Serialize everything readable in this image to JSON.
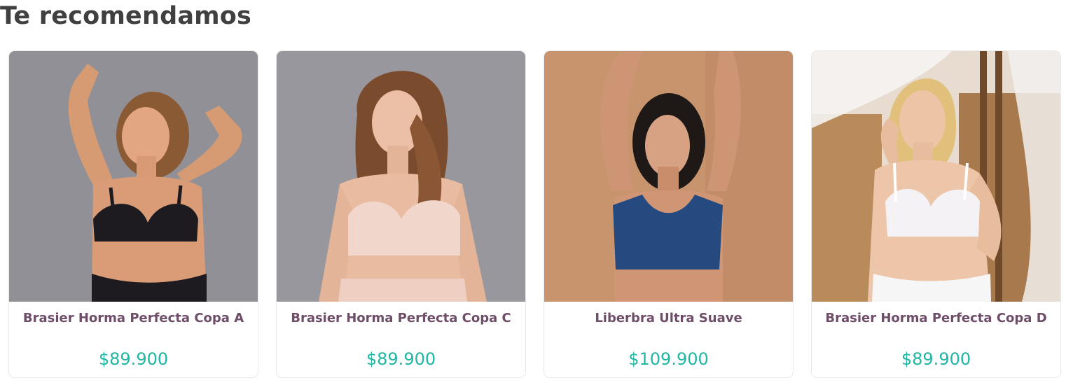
{
  "section": {
    "title": "Te recomendamos"
  },
  "colors": {
    "title": "#404040",
    "product_name": "#6d4d68",
    "price": "#1eb7a2",
    "card_border": "#e9e9e9"
  },
  "products": [
    {
      "name": "Brasier Horma Perfecta Copa A",
      "price": "$89.900",
      "image_background": "#8e8c92",
      "garment_color": "#1d1b1f",
      "hair_color": "#8a5a34"
    },
    {
      "name": "Brasier Horma Perfecta Copa C",
      "price": "$89.900",
      "image_background": "#98979d",
      "garment_color": "#f1d6cc",
      "hair_color": "#7a4b2c"
    },
    {
      "name": "Liberbra Ultra Suave",
      "price": "$109.900",
      "image_background": "#c8946e",
      "garment_color": "#244a80",
      "hair_color": "#1e1916"
    },
    {
      "name": "Brasier Horma Perfecta Copa D",
      "price": "$89.900",
      "image_background": "#e7dccf",
      "garment_color": "#f4f2f4",
      "hair_color": "#e0c07a"
    }
  ]
}
